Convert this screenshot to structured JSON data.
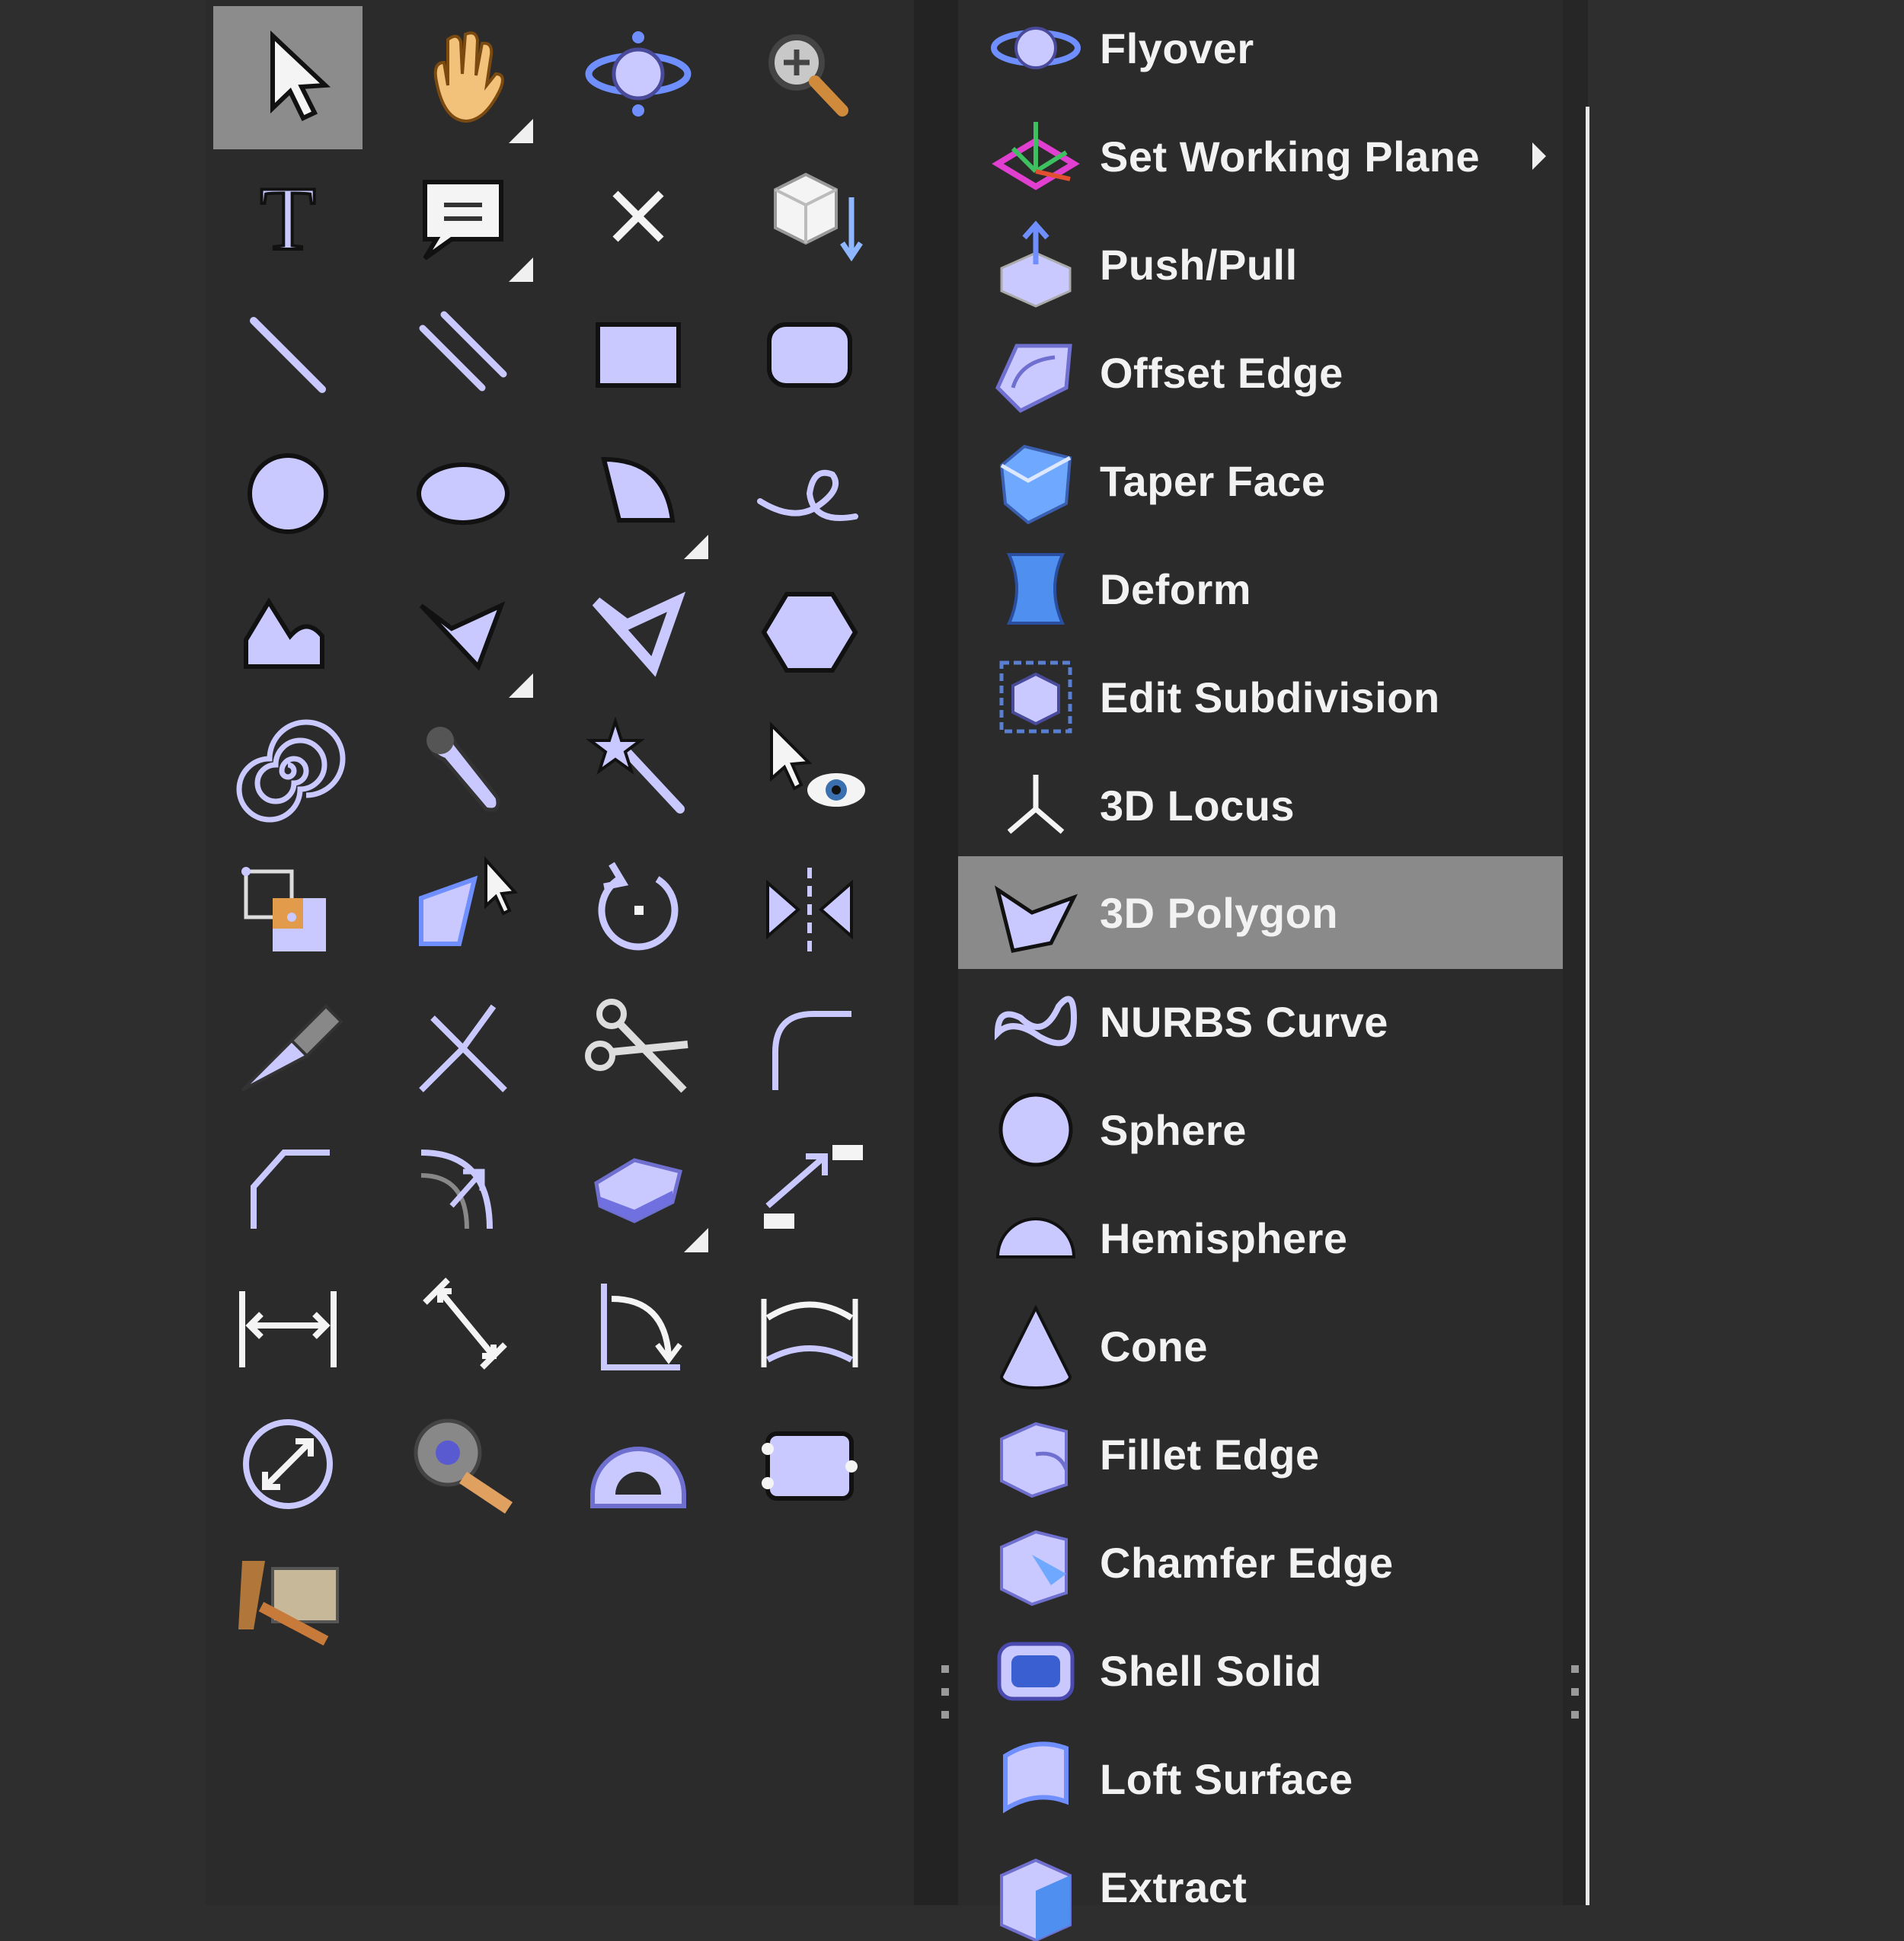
{
  "tool_palette": {
    "tools": [
      {
        "icon": "arrow-pointer-icon",
        "selected": true
      },
      {
        "icon": "pan-hand-icon",
        "has_submenu": true
      },
      {
        "icon": "flyover-orbit-icon"
      },
      {
        "icon": "zoom-magnifier-icon"
      },
      {
        "icon": "text-tool-icon"
      },
      {
        "icon": "callout-icon",
        "has_submenu": true
      },
      {
        "icon": "locus-x-icon"
      },
      {
        "icon": "working-plane-cube-icon"
      },
      {
        "icon": "line-tool-icon"
      },
      {
        "icon": "double-line-icon"
      },
      {
        "icon": "rectangle-icon"
      },
      {
        "icon": "rounded-rectangle-icon"
      },
      {
        "icon": "circle-icon"
      },
      {
        "icon": "oval-icon"
      },
      {
        "icon": "arc-icon",
        "has_submenu": true
      },
      {
        "icon": "freehand-icon"
      },
      {
        "icon": "polyline-icon"
      },
      {
        "icon": "polygon-icon",
        "has_submenu": true
      },
      {
        "icon": "double-polygon-icon"
      },
      {
        "icon": "hexagon-icon"
      },
      {
        "icon": "spiral-icon"
      },
      {
        "icon": "eyedropper-icon"
      },
      {
        "icon": "magic-wand-icon"
      },
      {
        "icon": "visibility-eye-icon"
      },
      {
        "icon": "reshape-icon"
      },
      {
        "icon": "selection-icon"
      },
      {
        "icon": "rotate-icon"
      },
      {
        "icon": "mirror-icon"
      },
      {
        "icon": "split-knife-icon"
      },
      {
        "icon": "connect-combine-icon"
      },
      {
        "icon": "trim-scissors-icon"
      },
      {
        "icon": "fillet-icon"
      },
      {
        "icon": "chamfer-icon"
      },
      {
        "icon": "offset-icon"
      },
      {
        "icon": "eraser-icon",
        "has_submenu": true
      },
      {
        "icon": "move-by-points-icon"
      },
      {
        "icon": "dimension-icon"
      },
      {
        "icon": "angular-dimension-icon"
      },
      {
        "icon": "arc-length-icon"
      },
      {
        "icon": "arc-dimension-icon"
      },
      {
        "icon": "diameter-icon"
      },
      {
        "icon": "tape-measure-icon"
      },
      {
        "icon": "protractor-icon"
      },
      {
        "icon": "data-tag-icon"
      },
      {
        "icon": "wood-tools-icon"
      }
    ]
  },
  "menu": {
    "items": [
      {
        "label": "Flyover",
        "icon": "flyover-icon"
      },
      {
        "label": "Set Working Plane",
        "icon": "set-working-plane-icon",
        "has_submenu": true
      },
      {
        "label": "Push/Pull",
        "icon": "push-pull-icon"
      },
      {
        "label": "Offset Edge",
        "icon": "offset-edge-icon"
      },
      {
        "label": "Taper Face",
        "icon": "taper-face-icon"
      },
      {
        "label": "Deform",
        "icon": "deform-icon"
      },
      {
        "label": "Edit Subdivision",
        "icon": "edit-subdivision-icon"
      },
      {
        "label": "3D Locus",
        "icon": "3d-locus-icon"
      },
      {
        "label": "3D Polygon",
        "icon": "3d-polygon-icon",
        "highlighted": true
      },
      {
        "label": "NURBS Curve",
        "icon": "nurbs-curve-icon"
      },
      {
        "label": "Sphere",
        "icon": "sphere-icon"
      },
      {
        "label": "Hemisphere",
        "icon": "hemisphere-icon"
      },
      {
        "label": "Cone",
        "icon": "cone-icon"
      },
      {
        "label": "Fillet Edge",
        "icon": "fillet-edge-icon"
      },
      {
        "label": "Chamfer Edge",
        "icon": "chamfer-edge-icon"
      },
      {
        "label": "Shell Solid",
        "icon": "shell-solid-icon"
      },
      {
        "label": "Loft Surface",
        "icon": "loft-surface-icon"
      },
      {
        "label": "Extract",
        "icon": "extract-icon"
      }
    ]
  },
  "colors": {
    "background": "#2e2e2e",
    "panel": "#2b2b2b",
    "selected": "#8c8c8c",
    "icon_fill": "#c9c9ff",
    "icon_stroke": "#4a4a9a",
    "text": "#f2f2f2"
  }
}
